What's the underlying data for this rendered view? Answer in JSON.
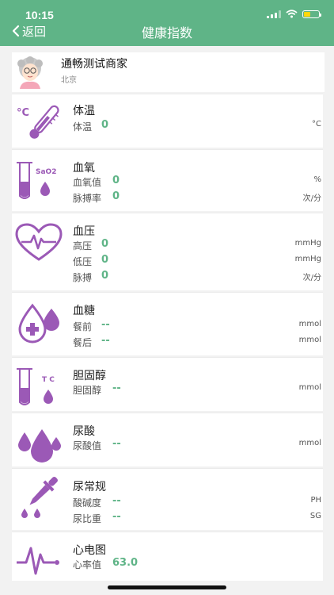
{
  "status": {
    "time": "10:15"
  },
  "header": {
    "back_label": "返回",
    "title": "健康指数"
  },
  "merchant": {
    "name": "通畅测试商家",
    "city": "北京"
  },
  "colors": {
    "accent": "#5fb487",
    "icon": "#9b59b6"
  },
  "cards": [
    {
      "title": "体温",
      "icon": "thermometer-icon",
      "rows": [
        {
          "label": "体温",
          "value": "0",
          "unit": "°C"
        }
      ]
    },
    {
      "title": "血氧",
      "icon": "sao2-tube-icon",
      "icon_text": "SaO2",
      "rows": [
        {
          "label": "血氧值",
          "value": "0",
          "unit": "%"
        },
        {
          "label": "脉搏率",
          "value": "0",
          "unit": "次/分"
        }
      ]
    },
    {
      "title": "血压",
      "icon": "heart-pulse-icon",
      "rows": [
        {
          "label": "高压",
          "value": "0",
          "unit": "mmHg"
        },
        {
          "label": "低压",
          "value": "0",
          "unit": "mmHg"
        },
        {
          "label": "脉搏",
          "value": "0",
          "unit": "次/分"
        }
      ]
    },
    {
      "title": "血糖",
      "icon": "blood-drop-plus-icon",
      "rows": [
        {
          "label": "餐前",
          "value": "--",
          "unit": "mmol"
        },
        {
          "label": "餐后",
          "value": "--",
          "unit": "mmol"
        }
      ]
    },
    {
      "title": "胆固醇",
      "icon": "tc-tube-icon",
      "icon_text": "T C",
      "rows": [
        {
          "label": "胆固醇",
          "value": "--",
          "unit": "mmol"
        }
      ]
    },
    {
      "title": "尿酸",
      "icon": "drops-icon",
      "rows": [
        {
          "label": "尿酸值",
          "value": "--",
          "unit": "mmol"
        }
      ]
    },
    {
      "title": "尿常规",
      "icon": "dropper-icon",
      "rows": [
        {
          "label": "酸碱度",
          "value": "--",
          "unit": "PH"
        },
        {
          "label": "尿比重",
          "value": "--",
          "unit": "SG"
        }
      ]
    },
    {
      "title": "心电图",
      "icon": "ecg-icon",
      "rows": [
        {
          "label": "心率值",
          "value": "63.0",
          "unit": ""
        }
      ]
    }
  ]
}
